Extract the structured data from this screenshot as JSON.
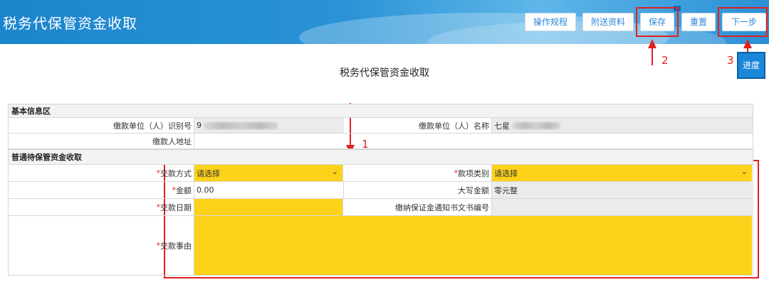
{
  "header": {
    "title": "税务代保管资金收取",
    "buttons": {
      "rules": "操作规程",
      "attach": "附送资料",
      "save": "保存",
      "reset": "重置",
      "next": "下一步"
    },
    "progress": "进度"
  },
  "annotations": {
    "n1": "1",
    "n2": "2",
    "n3": "3"
  },
  "form": {
    "title": "税务代保管资金收取",
    "sections": {
      "basic": "基本信息区",
      "general": "普通待保管资金收取"
    },
    "fields": {
      "payer_id_label": "缴款单位（人）识别号",
      "payer_id_value": "9",
      "payer_name_label": "缴款单位（人）名称",
      "payer_name_value": "七星",
      "payer_addr_label": "缴款人地址",
      "pay_method_label": "交款方式",
      "pay_method_value": "请选择",
      "item_type_label": "款项类别",
      "item_type_value": "请选择",
      "amount_label": "金额",
      "amount_value": "0.00",
      "amount_upper_label": "大写金额",
      "amount_upper_value": "零元整",
      "pay_date_label": "交款日期",
      "notice_no_label": "缴纳保证金通知书文书编号",
      "reason_label": "交款事由"
    },
    "required_mark": "*"
  },
  "colors": {
    "accent": "#2a93d6",
    "annotation": "#e0201f",
    "required_fill": "#fcd21a"
  }
}
